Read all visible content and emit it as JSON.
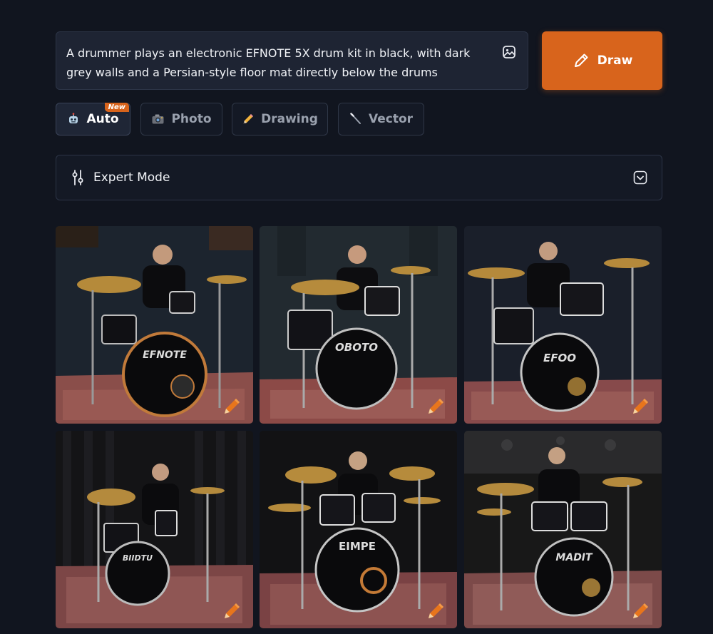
{
  "prompt": {
    "text_line1": "A drummer plays an electronic EFNOTE 5X drum kit in black, with dark",
    "text_line2": "grey walls and a Persian-style floor mat directly below the drums",
    "attach_icon": "image-icon"
  },
  "draw_button": {
    "label": "Draw",
    "icon": "pencil-icon",
    "color": "#d8641c"
  },
  "style_tabs": [
    {
      "label": "Auto",
      "icon": "robot-icon",
      "badge": "New",
      "active": true
    },
    {
      "label": "Photo",
      "icon": "camera-icon",
      "active": false
    },
    {
      "label": "Drawing",
      "icon": "pencil-icon",
      "active": false
    },
    {
      "label": "Vector",
      "icon": "brush-icon",
      "active": false
    }
  ],
  "expert_mode": {
    "label": "Expert Mode",
    "icon": "sliders-icon",
    "toggle_icon": "chevron-down-icon"
  },
  "results": [
    {
      "name": "result-image-1",
      "drum_text": "EFNOTE"
    },
    {
      "name": "result-image-2",
      "drum_text": "OBOTO"
    },
    {
      "name": "result-image-3",
      "drum_text": "EFOO"
    },
    {
      "name": "result-image-4",
      "drum_text": "BIIDTU"
    },
    {
      "name": "result-image-5",
      "drum_text": "EIMPE"
    },
    {
      "name": "result-image-6",
      "drum_text": "MADIT"
    }
  ],
  "colors": {
    "background": "#11151f",
    "accent": "#d8641c",
    "panel": "#1e2433"
  }
}
